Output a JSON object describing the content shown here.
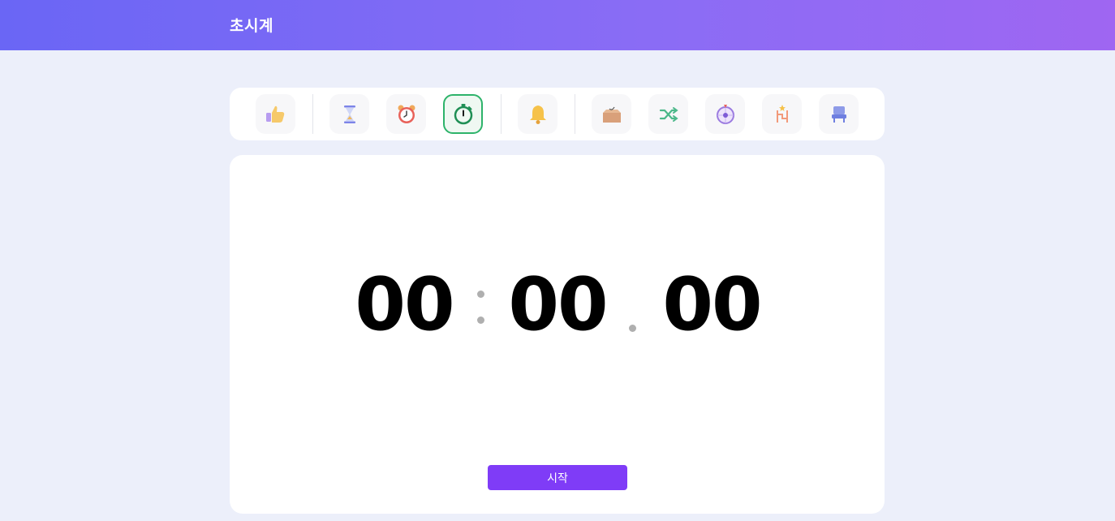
{
  "header": {
    "title": "초시계"
  },
  "toolbar": {
    "items": [
      {
        "name": "thumbs-up",
        "icon": "thumbs-up-icon",
        "active": false
      },
      {
        "name": "hourglass",
        "icon": "hourglass-icon",
        "active": false
      },
      {
        "name": "alarm-clock",
        "icon": "alarm-clock-icon",
        "active": false
      },
      {
        "name": "stopwatch",
        "icon": "stopwatch-icon",
        "active": true
      },
      {
        "name": "bell",
        "icon": "bell-icon",
        "active": false
      },
      {
        "name": "box",
        "icon": "box-icon",
        "active": false
      },
      {
        "name": "shuffle",
        "icon": "shuffle-icon",
        "active": false
      },
      {
        "name": "roulette",
        "icon": "roulette-icon",
        "active": false
      },
      {
        "name": "ladder",
        "icon": "ladder-icon",
        "active": false
      },
      {
        "name": "seat",
        "icon": "seat-icon",
        "active": false
      }
    ]
  },
  "stopwatch": {
    "minutes": "00",
    "seconds": "00",
    "centiseconds": "00"
  },
  "controls": {
    "start_label": "시작"
  },
  "colors": {
    "header_start": "#6A66F5",
    "header_end": "#9F66F2",
    "background": "#ECEFFA",
    "accent_button": "#7F3CF7",
    "active_border": "#2DB36A"
  }
}
